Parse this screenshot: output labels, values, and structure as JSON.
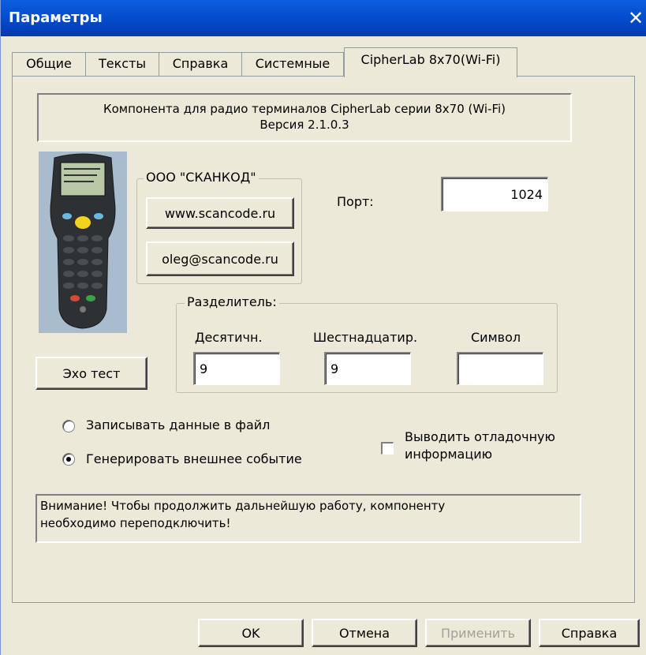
{
  "window": {
    "title": "Параметры",
    "close_glyph": "✕"
  },
  "tabs": [
    {
      "label": "Общие",
      "active": false
    },
    {
      "label": "Тексты",
      "active": false
    },
    {
      "label": "Справка",
      "active": false
    },
    {
      "label": "Системные",
      "active": false
    },
    {
      "label": "CipherLab 8x70(Wi-Fi)",
      "active": true
    }
  ],
  "banner": {
    "line1": "Компонента для радио терминалов CipherLab серии 8x70 (Wi-Fi)",
    "line2": "Версия 2.1.0.3"
  },
  "company": {
    "legend": "ООО \"СКАНКОД\"",
    "website_button": "www.scancode.ru",
    "email_button": "oleg@scancode.ru"
  },
  "port": {
    "label": "Порт:",
    "value": "1024"
  },
  "separator": {
    "legend": "Разделитель:",
    "decimal_label": "Десятичн.",
    "decimal_value": "9",
    "hex_label": "Шестнадцатир.",
    "hex_value": "9",
    "symbol_label": "Символ",
    "symbol_value": ""
  },
  "echo_test_button": "Эхо тест",
  "options": {
    "write_file_label": "Записывать данные в файл",
    "write_file_selected": false,
    "external_event_label": "Генерировать внешнее событие",
    "external_event_selected": true,
    "debug_label_line1": "Выводить отладочную",
    "debug_label_line2": "информацию",
    "debug_checked": false
  },
  "warning": {
    "line1": "Внимание! Чтобы продолжить дальнейшую работу, компоненту",
    "line2": "необходимо переподключить!"
  },
  "footer": {
    "ok": "OK",
    "cancel": "Отмена",
    "apply": "Применить",
    "help": "Справка"
  },
  "colors": {
    "titlebar": "#0348c8",
    "dialog_bg": "#ECE9D8",
    "disabled_text": "#a0a0a0"
  }
}
